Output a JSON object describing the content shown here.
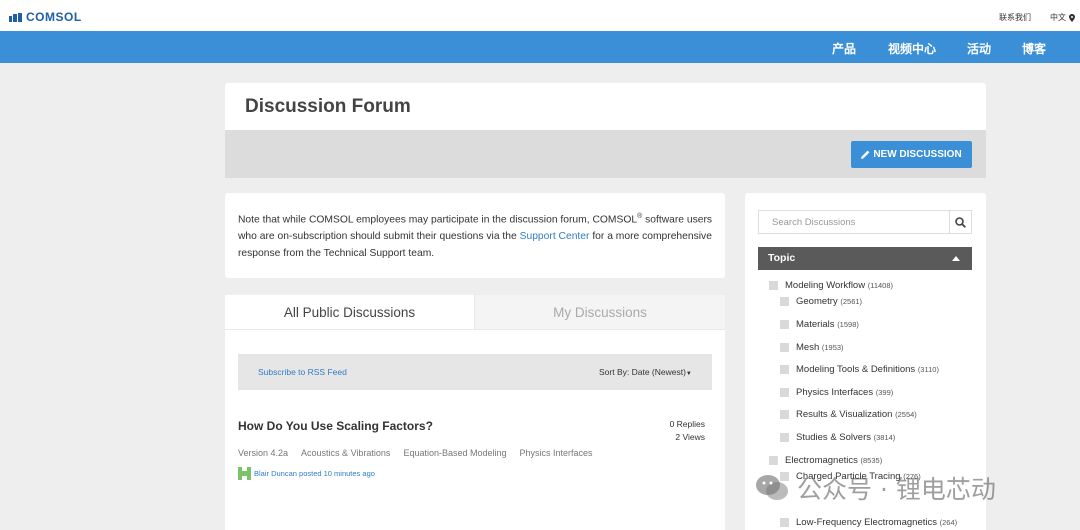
{
  "topbar": {
    "logo_text": "COMSOL",
    "contact_label": "联系我们",
    "lang_label": "中文"
  },
  "nav": {
    "items": [
      {
        "label": "产品"
      },
      {
        "label": "视频中心"
      },
      {
        "label": "活动"
      },
      {
        "label": "博客"
      }
    ]
  },
  "forum": {
    "title": "Discussion Forum",
    "new_discussion_label": "NEW DISCUSSION"
  },
  "note": {
    "text_before": "Note that while COMSOL employees may participate in the discussion forum, COMSOL",
    "reg_mark": "®",
    "text_middle": " software users who are on-subscription should submit their questions via the ",
    "link_label": "Support Center",
    "text_after": " for a more comprehensive response from the Technical Support team."
  },
  "tabs": [
    {
      "label": "All Public Discussions"
    },
    {
      "label": "My Discussions"
    }
  ],
  "filter": {
    "rss_label": "Subscribe to RSS Feed",
    "sort_label": "Sort By: Date (Newest)"
  },
  "discussion": {
    "title": "How Do You Use Scaling Factors?",
    "replies": "0 Replies",
    "views": "2 Views",
    "tags": [
      "Version 4.2a",
      "Acoustics & Vibrations",
      "Equation-Based Modeling",
      "Physics Interfaces"
    ],
    "meta": "Blair Duncan posted 10 minutes ago"
  },
  "sidebar": {
    "search_placeholder": "Search Discussions",
    "topic_label": "Topic",
    "topics": [
      {
        "label": "Modeling Workflow",
        "count": "(11408)"
      },
      {
        "label": "Geometry",
        "count": "(2561)"
      },
      {
        "label": "Materials",
        "count": "(1598)"
      },
      {
        "label": "Mesh",
        "count": "(1953)"
      },
      {
        "label": "Modeling Tools & Definitions",
        "count": "(3110)"
      },
      {
        "label": "Physics Interfaces",
        "count": "(399)"
      },
      {
        "label": "Results & Visualization",
        "count": "(2554)"
      },
      {
        "label": "Studies & Solvers",
        "count": "(3814)"
      },
      {
        "label": "Electromagnetics",
        "count": "(8535)"
      },
      {
        "label": "Charged Particle Tracing",
        "count": "(276)"
      },
      {
        "label": "Low-Frequency Electromagnetics",
        "count": "(264)"
      }
    ]
  },
  "watermark": {
    "text": "公众号 · 锂电芯动"
  },
  "colors": {
    "nav_blue": "#3a8fd6",
    "link_blue": "#2f7dc4",
    "topic_header": "#5a5a5a"
  }
}
